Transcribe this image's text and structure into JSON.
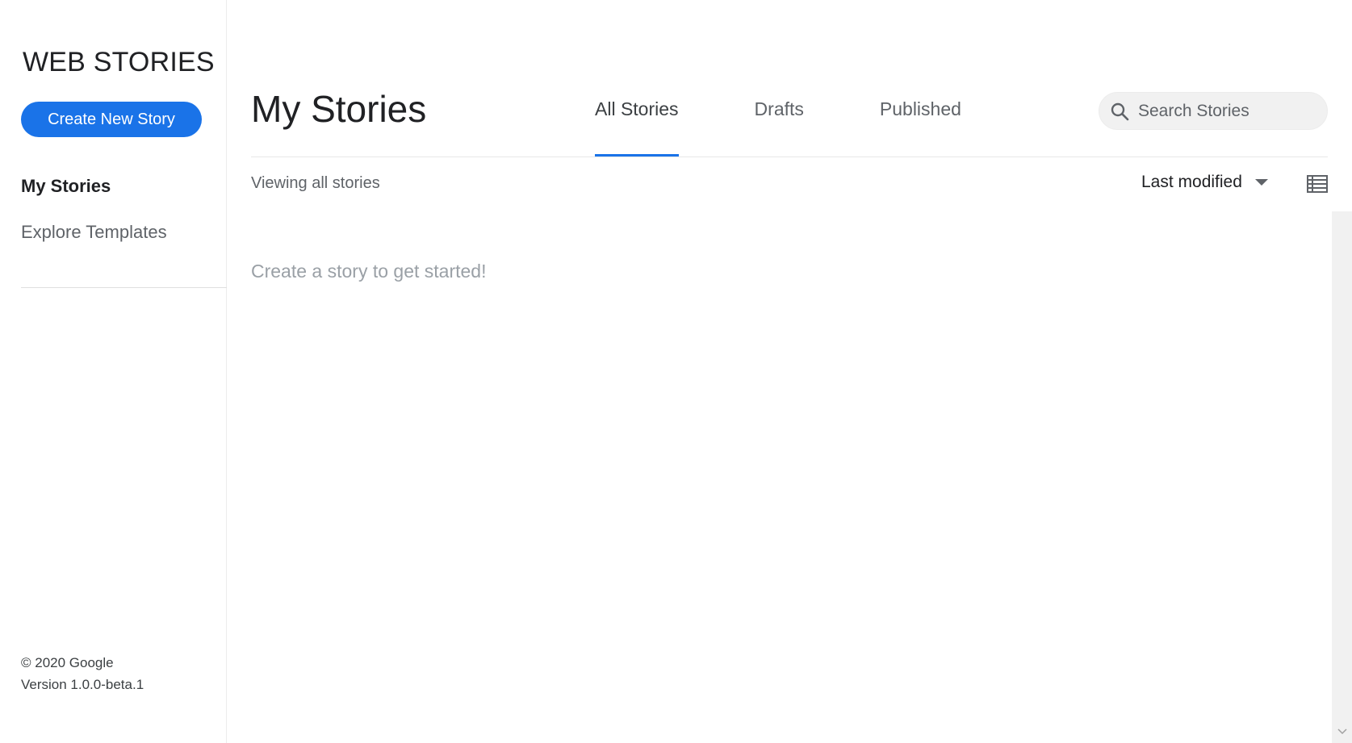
{
  "sidebar": {
    "brand": "WEB STORIES",
    "create_button": "Create New Story",
    "nav": [
      {
        "label": "My Stories",
        "active": true
      },
      {
        "label": "Explore Templates",
        "active": false
      }
    ],
    "footer": {
      "copyright": "© 2020 Google",
      "version": "Version 1.0.0-beta.1"
    }
  },
  "main": {
    "title": "My Stories",
    "tabs": [
      {
        "label": "All Stories",
        "active": true
      },
      {
        "label": "Drafts",
        "active": false
      },
      {
        "label": "Published",
        "active": false
      }
    ],
    "search": {
      "placeholder": "Search Stories",
      "icon": "search-icon"
    },
    "viewing_label": "Viewing all stories",
    "sort": {
      "selected": "Last modified"
    },
    "view_toggle_icon": "list-view-icon",
    "empty_message": "Create a story to get started!"
  },
  "colors": {
    "accent": "#1a73e8",
    "text_primary": "#202124",
    "text_secondary": "#5f6368",
    "muted": "#9aa0a6"
  }
}
